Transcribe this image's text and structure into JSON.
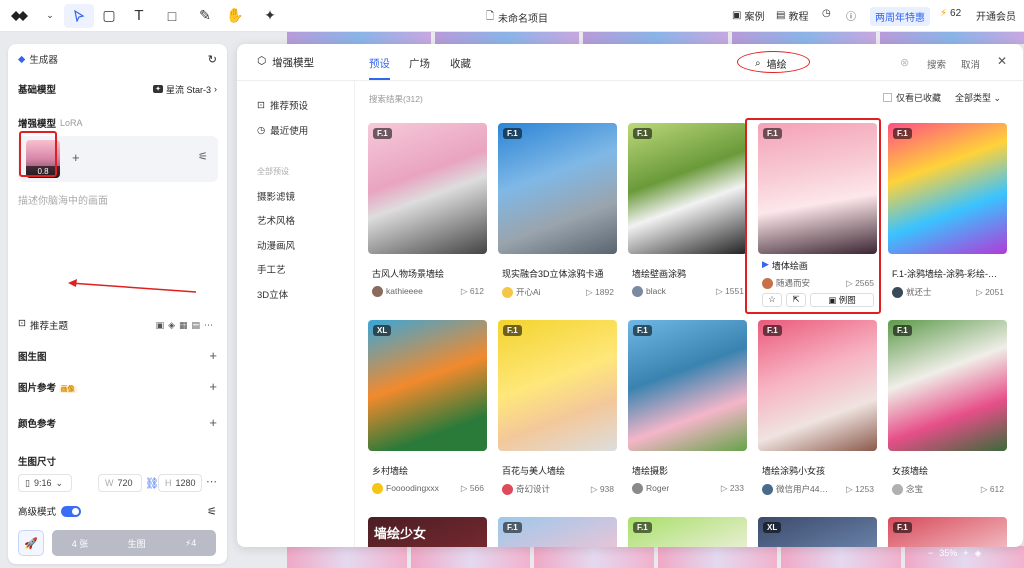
{
  "topbar": {
    "doc_title": "未命名项目",
    "cases": "案例",
    "tutorial": "教程",
    "anniversary": "两周年特惠",
    "points": "62",
    "member": "开通会员"
  },
  "generator": {
    "title": "生成器",
    "base_model_label": "基础模型",
    "base_model_value": "星流 Star-3",
    "enhance_label": "增强模型",
    "enhance_sub": "LoRA",
    "lora_weight": "0.8",
    "prompt_placeholder": "描述你脑海中的画面",
    "recommend_label": "推荐主题",
    "img2img": "图生图",
    "img_ref": "图片参考",
    "img_ref_badge": "画像",
    "color_ref": "颜色参考",
    "size_label": "生图尺寸",
    "ratio": "9:16",
    "w_label": "W",
    "w_value": "720",
    "h_label": "H",
    "h_value": "1280",
    "hd_label": "高级模式",
    "count": "4 张",
    "gen_label": "生图",
    "gen_cost": "4"
  },
  "modal": {
    "title": "增强模型",
    "tabs": [
      "预设",
      "广场",
      "收藏"
    ],
    "search_value": "墙绘",
    "search_btn": "搜索",
    "cancel_btn": "取消",
    "result_count": "搜索结果(312)",
    "only_fav": "仅看已收藏",
    "all_types": "全部类型",
    "side": {
      "recommend": "推荐预设",
      "recent": "最近使用",
      "all_header": "全部预设",
      "categories": [
        "摄影滤镜",
        "艺术风格",
        "动漫画风",
        "手工艺",
        "3D立体"
      ]
    },
    "cards": [
      {
        "tag": "F.1",
        "title": "古风人物场景墙绘",
        "user": "kathieeee",
        "count": "612"
      },
      {
        "tag": "F.1",
        "title": "现实融合3D立体涂鸦卡通",
        "user": "开心Ai",
        "count": "1892"
      },
      {
        "tag": "F.1",
        "title": "墙绘壁画涂鸦",
        "user": "black",
        "count": "1551"
      },
      {
        "tag": "F.1",
        "title": "墙体绘画",
        "user": "随遇而安",
        "count": "2565",
        "example": "例图"
      },
      {
        "tag": "F.1",
        "title": "F.1-涂鸦墙绘-涂鸦-彩绘-…",
        "user": "就还士",
        "count": "2051"
      },
      {
        "tag": "XL",
        "title": "乡村墙绘",
        "user": "Foooodingxxx",
        "count": "566"
      },
      {
        "tag": "F.1",
        "title": "百花与美人墙绘",
        "user": "奇幻设计",
        "count": "938"
      },
      {
        "tag": "F.1",
        "title": "墙绘摄影",
        "user": "Roger",
        "count": "233"
      },
      {
        "tag": "F.1",
        "title": "墙绘涂鸦小女孩",
        "user": "微信用户44…",
        "count": "1253"
      },
      {
        "tag": "F.1",
        "title": "女孩墙绘",
        "user": "念宝",
        "count": "612"
      },
      {
        "tag": "",
        "title": "墙绘少女",
        "user": "",
        "count": ""
      },
      {
        "tag": "F.1",
        "title": "",
        "user": "",
        "count": ""
      },
      {
        "tag": "F.1",
        "title": "",
        "user": "",
        "count": ""
      },
      {
        "tag": "XL",
        "title": "",
        "user": "",
        "count": ""
      },
      {
        "tag": "F.1",
        "title": "",
        "user": "",
        "count": ""
      }
    ]
  },
  "zoom": "35%",
  "colors": {
    "accent": "#3366ee",
    "highlight": "#e02020"
  }
}
